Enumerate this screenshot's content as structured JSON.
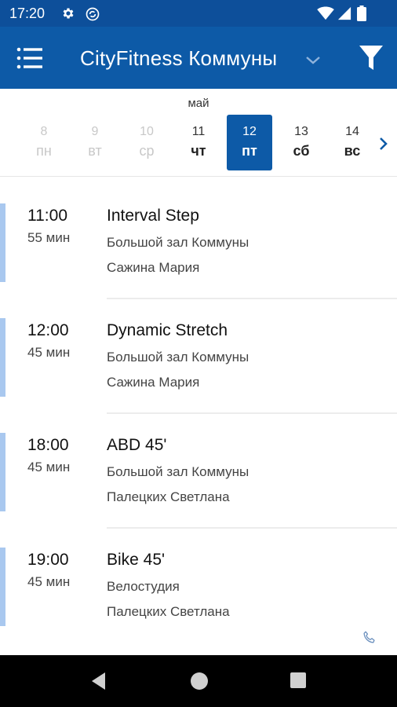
{
  "status_bar": {
    "time": "17:20",
    "icons": [
      "gear-icon",
      "sync-icon",
      "wifi-icon",
      "signal-icon",
      "battery-icon"
    ]
  },
  "app_bar": {
    "title": "CityFitness Коммуны",
    "icons": [
      "menu-icon",
      "chevron-down-icon",
      "filter-icon"
    ],
    "background_color": "#0d5aa7"
  },
  "calendar": {
    "month": "май",
    "days": [
      {
        "num": "8",
        "dow": "пн",
        "state": "disabled"
      },
      {
        "num": "9",
        "dow": "вт",
        "state": "disabled"
      },
      {
        "num": "10",
        "dow": "ср",
        "state": "disabled"
      },
      {
        "num": "11",
        "dow": "чт",
        "state": "normal"
      },
      {
        "num": "12",
        "dow": "пт",
        "state": "selected"
      },
      {
        "num": "13",
        "dow": "сб",
        "state": "normal"
      },
      {
        "num": "14",
        "dow": "вс",
        "state": "normal"
      }
    ],
    "selected_color": "#0d5aa7"
  },
  "sessions": [
    {
      "time": "11:00",
      "duration": "55 мин",
      "title": "Interval Step",
      "room": "Большой зал Коммуны",
      "trainer": "Сажина Мария"
    },
    {
      "time": "12:00",
      "duration": "45 мин",
      "title": "Dynamic Stretch",
      "room": "Большой зал Коммуны",
      "trainer": "Сажина Мария"
    },
    {
      "time": "18:00",
      "duration": "45 мин",
      "title": "ABD 45'",
      "room": "Большой зал Коммуны",
      "trainer": "Палецких Светлана"
    },
    {
      "time": "19:00",
      "duration": "45 мин",
      "title": "Bike 45'",
      "room": "Велостудия",
      "trainer": "Палецких Светлана"
    }
  ],
  "accent_color": "#a9c8ef",
  "nav_bar": {
    "icons": [
      "back-icon",
      "home-icon",
      "recent-apps-icon"
    ]
  }
}
